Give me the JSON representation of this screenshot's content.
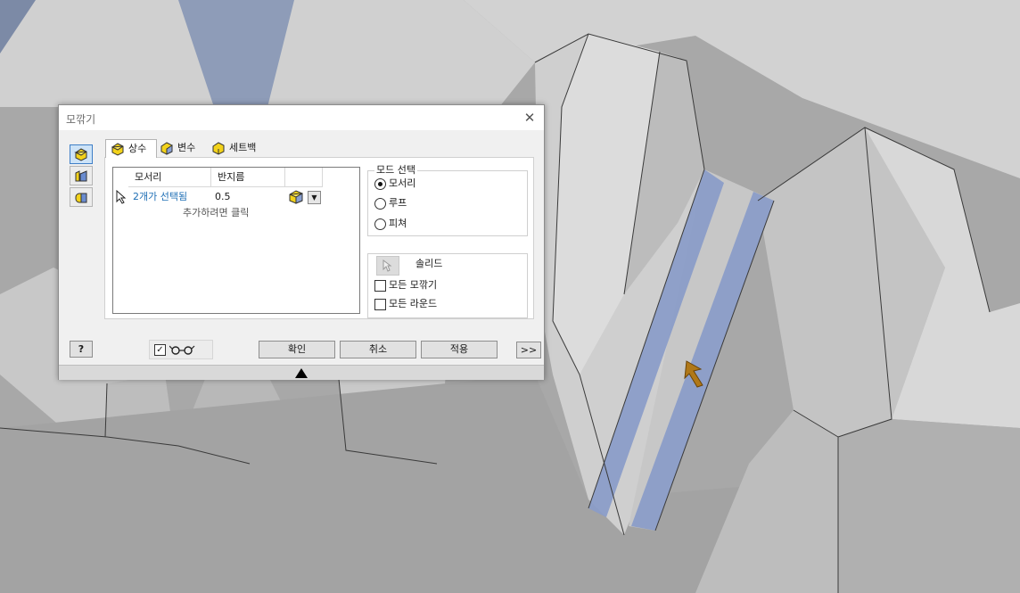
{
  "dialog": {
    "title": "모깎기",
    "close_glyph": "✕",
    "tabs": [
      {
        "label": "상수",
        "icon": "fillet-constant-icon",
        "active": true
      },
      {
        "label": "변수",
        "icon": "fillet-variable-icon",
        "active": false
      },
      {
        "label": "세트백",
        "icon": "setback-icon",
        "active": false
      }
    ],
    "side_modes": [
      {
        "icon": "edge-fillet-icon",
        "active": true
      },
      {
        "icon": "face-fillet-icon",
        "active": false
      },
      {
        "icon": "full-round-fillet-icon",
        "active": false
      }
    ],
    "grid": {
      "columns": [
        "모서리",
        "반지름"
      ],
      "rows": [
        {
          "edges": "2개가 선택됨",
          "radius": "0.5"
        }
      ],
      "add_hint": "추가하려면 클릭"
    },
    "mode_group": {
      "legend": "모드 선택",
      "options": [
        {
          "label": "모서리",
          "selected": true
        },
        {
          "label": "루프",
          "selected": false
        },
        {
          "label": "피쳐",
          "selected": false
        }
      ]
    },
    "solid_group": {
      "label": "솔리드",
      "checks": [
        {
          "label": "모든 모깎기",
          "checked": false
        },
        {
          "label": "모든 라운드",
          "checked": false
        }
      ]
    },
    "footer": {
      "help_glyph": "?",
      "ok": "확인",
      "cancel": "취소",
      "apply": "적용",
      "more": ">>",
      "preview_checked": true
    }
  },
  "colors": {
    "selected_edge": "#8b9dc8",
    "link_text": "#1f6fb5",
    "dialog_bg": "#f0f0f0"
  }
}
